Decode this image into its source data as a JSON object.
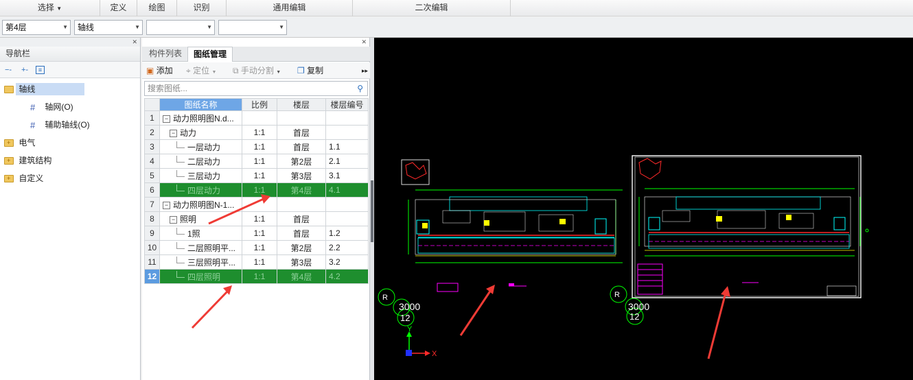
{
  "ribbon": {
    "groups": [
      "选择",
      "定义",
      "绘图",
      "识别",
      "通用编辑",
      "二次编辑"
    ],
    "select_arrow": "▼"
  },
  "selectors": {
    "floor": "第4层",
    "layer": "轴线",
    "combo3": "",
    "combo4": ""
  },
  "nav": {
    "title": "导航栏",
    "tree": [
      {
        "label": "轴线",
        "selected": true
      },
      {
        "label": "轴网(O)"
      },
      {
        "label": "辅助轴线(O)"
      },
      {
        "label": "电气"
      },
      {
        "label": "建筑结构"
      },
      {
        "label": "自定义"
      }
    ]
  },
  "drawings": {
    "tabs": [
      "构件列表",
      "图纸管理"
    ],
    "active_tab": "图纸管理",
    "toolbar": {
      "add": "添加",
      "locate": "定位",
      "split": "手动分割",
      "copy": "复制"
    },
    "search_placeholder": "搜索图纸...",
    "columns": [
      "图纸名称",
      "比例",
      "楼层",
      "楼层编号"
    ],
    "rows": [
      {
        "no": "1",
        "name": "动力照明图N.d...",
        "scale": "",
        "floor": "",
        "floor_no": "",
        "level": 0,
        "toggle": "−"
      },
      {
        "no": "2",
        "name": "动力",
        "scale": "1:1",
        "floor": "首层",
        "floor_no": "",
        "level": 1,
        "toggle": "−"
      },
      {
        "no": "3",
        "name": "一层动力",
        "scale": "1:1",
        "floor": "首层",
        "floor_no": "1.1",
        "level": 2
      },
      {
        "no": "4",
        "name": "二层动力",
        "scale": "1:1",
        "floor": "第2层",
        "floor_no": "2.1",
        "level": 2
      },
      {
        "no": "5",
        "name": "三层动力",
        "scale": "1:1",
        "floor": "第3层",
        "floor_no": "3.1",
        "level": 2
      },
      {
        "no": "6",
        "name": "四层动力",
        "scale": "1:1",
        "floor": "第4层",
        "floor_no": "4.1",
        "level": 2,
        "highlight": true
      },
      {
        "no": "7",
        "name": "动力照明图N-1...",
        "scale": "",
        "floor": "",
        "floor_no": "",
        "level": 0,
        "toggle": "−"
      },
      {
        "no": "8",
        "name": "照明",
        "scale": "1:1",
        "floor": "首层",
        "floor_no": "",
        "level": 1,
        "toggle": "−"
      },
      {
        "no": "9",
        "name": "1照",
        "scale": "1:1",
        "floor": "首层",
        "floor_no": "1.2",
        "level": 2
      },
      {
        "no": "10",
        "name": "二层照明平...",
        "scale": "1:1",
        "floor": "第2层",
        "floor_no": "2.2",
        "level": 2
      },
      {
        "no": "11",
        "name": "三层照明平...",
        "scale": "1:1",
        "floor": "第3层",
        "floor_no": "3.2",
        "level": 2
      },
      {
        "no": "12",
        "name": "四层照明",
        "scale": "1:1",
        "floor": "第4层",
        "floor_no": "4.2",
        "level": 2,
        "highlight": true,
        "current": true
      }
    ]
  },
  "canvas": {
    "label_3000": "3000",
    "label_12": "12",
    "axis_y": "Y",
    "axis_x": "X",
    "colors": {
      "background": "#000000",
      "green": "#00ff00",
      "magenta": "#ff00ff",
      "cyan": "#00ffff",
      "yellow": "#ffff00",
      "red": "#ff2a2a",
      "arrow": "#ef3b35",
      "highlight_row": "#1e8e2e"
    }
  }
}
